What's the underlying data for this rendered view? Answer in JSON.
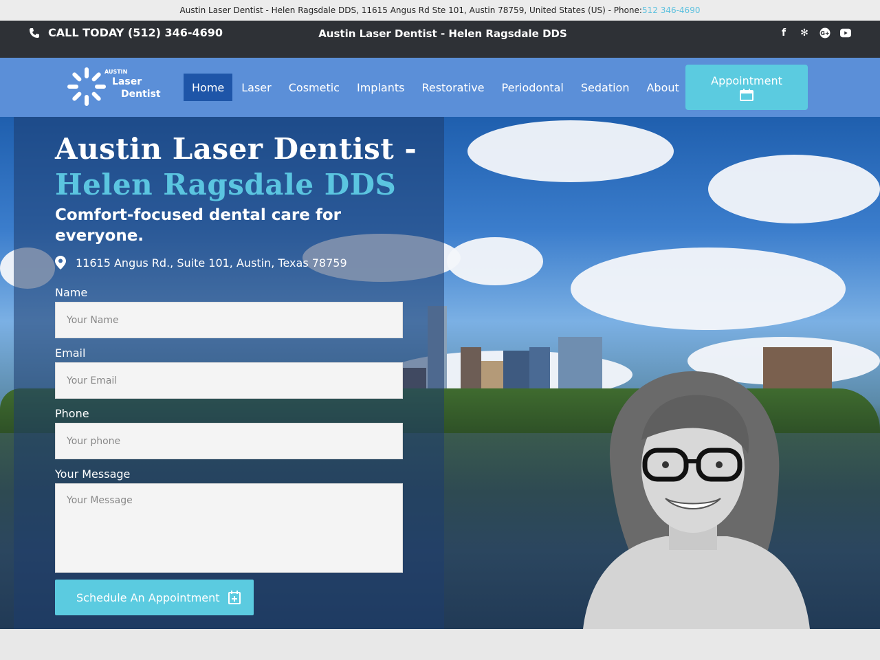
{
  "topstrip": {
    "info": "Austin Laser Dentist - Helen Ragsdale DDS, 11615 Angus Rd Ste 101, Austin 78759, United States (US) - Phone: ",
    "phone": "512 346-4690"
  },
  "callbar": {
    "call_text": "CALL TODAY (512) 346-4690",
    "title": "Austin Laser Dentist - Helen Ragsdale DDS",
    "social_icons": [
      "facebook-icon",
      "yelp-icon",
      "google-plus-icon",
      "youtube-icon"
    ]
  },
  "logo": {
    "small": "AUSTIN",
    "line1": "Laser",
    "line2": "Dentist"
  },
  "nav": {
    "items": [
      "Home",
      "Laser",
      "Cosmetic",
      "Implants",
      "Restorative",
      "Periodontal",
      "Sedation",
      "About"
    ],
    "active": "Home",
    "appointment_label": "Appointment"
  },
  "hero": {
    "title_line1": "Austin Laser Dentist -",
    "title_line2": "Helen Ragsdale DDS",
    "subtitle": "Comfort-focused dental care for everyone.",
    "address": "11615 Angus Rd., Suite 101, Austin, Texas 78759"
  },
  "form": {
    "name_label": "Name",
    "name_placeholder": "Your Name",
    "email_label": "Email",
    "email_placeholder": "Your Email",
    "phone_label": "Phone",
    "phone_placeholder": "Your phone",
    "message_label": "Your Message",
    "message_placeholder": "Your Message",
    "submit_label": "Schedule An Appointment"
  },
  "colors": {
    "nav_bg": "#5b8fd8",
    "active_nav": "#1e55a8",
    "accent": "#5bcbe0",
    "dark_bar": "#2e3136"
  }
}
